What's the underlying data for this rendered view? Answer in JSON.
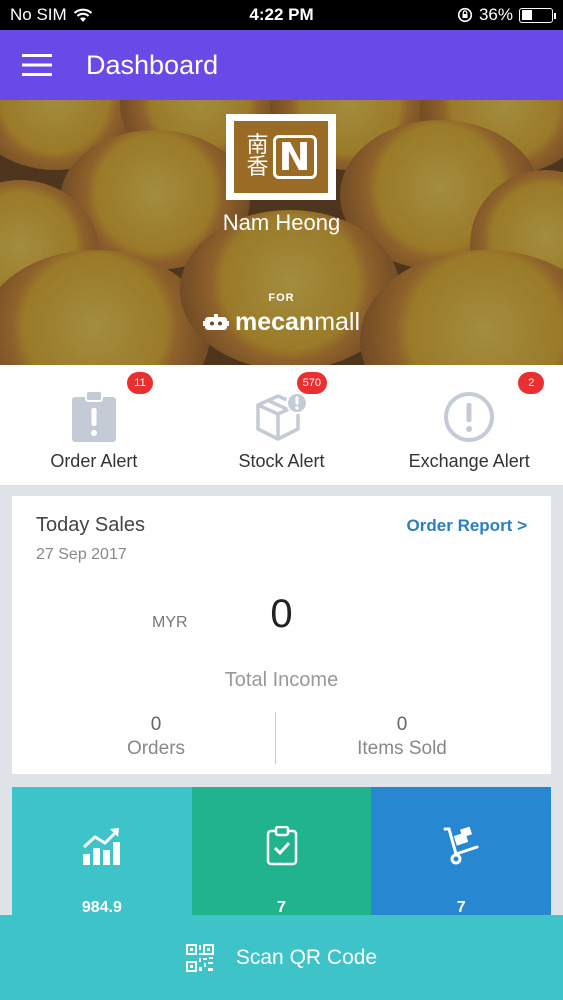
{
  "status_bar": {
    "carrier": "No SIM",
    "time": "4:22 PM",
    "battery": "36%"
  },
  "header": {
    "title": "Dashboard",
    "menu_icon": "hamburger-menu-icon"
  },
  "hero": {
    "store_name": "Nam Heong",
    "logo_text": "南香",
    "for_label": "FOR",
    "brand_prefix": "mecan",
    "brand_suffix": "mall"
  },
  "alerts": [
    {
      "label": "Order Alert",
      "count": "11",
      "icon": "clipboard-alert-icon"
    },
    {
      "label": "Stock Alert",
      "count": "570",
      "icon": "box-alert-icon"
    },
    {
      "label": "Exchange Alert",
      "count": "2",
      "icon": "exclamation-circle-icon"
    }
  ],
  "sales": {
    "title": "Today Sales",
    "date": "27 Sep 2017",
    "report_link": "Order Report >",
    "currency": "MYR",
    "total_income": "0",
    "total_income_label": "Total Income",
    "orders": "0",
    "orders_label": "Orders",
    "items_sold": "0",
    "items_sold_label": "Items Sold"
  },
  "tiles": [
    {
      "value": "984.9",
      "icon": "growth-chart-icon",
      "color": "#3ec3c9"
    },
    {
      "value": "7",
      "icon": "clipboard-check-icon",
      "color": "#21b38d"
    },
    {
      "value": "7",
      "icon": "hand-truck-icon",
      "color": "#2787d0"
    }
  ],
  "bottom": {
    "scan_label": "Scan QR Code",
    "icon": "qr-code-icon"
  },
  "colors": {
    "header": "#6a4ae6",
    "badge": "#e93030",
    "link": "#2a7fbf",
    "scan_bar": "#3ec3c9"
  }
}
